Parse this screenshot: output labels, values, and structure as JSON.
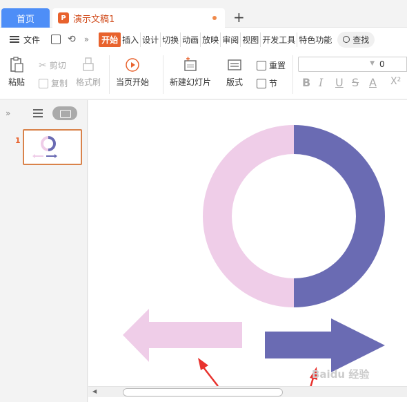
{
  "tabs": {
    "home_label": "首页",
    "doc_title": "演示文稿1",
    "add_label": "+"
  },
  "menu": {
    "file_label": "文件",
    "more_label": "»",
    "tabs": [
      "开始",
      "插入",
      "设计",
      "切换",
      "动画",
      "放映",
      "审阅",
      "视图",
      "开发工具",
      "特色功能"
    ],
    "search_label": "查找"
  },
  "ribbon": {
    "paste": "粘贴",
    "cut": "剪切",
    "copy": "复制",
    "format_painter": "格式刷",
    "play_from_current": "当页开始",
    "new_slide": "新建幻灯片",
    "layout": "版式",
    "reset": "重置",
    "section": "节",
    "font_size_value": "0",
    "format_buttons": [
      "B",
      "I",
      "U",
      "S",
      "A",
      "X²"
    ]
  },
  "sidepanel": {
    "collapse": "»",
    "slide_number": "1"
  },
  "colors": {
    "light_pink": "#efcde8",
    "purple": "#6a6bb3",
    "red_arrow": "#e8322e",
    "accent_orange": "#e8622d",
    "home_blue": "#4e8ef7"
  },
  "watermark": "Baidu 经验"
}
